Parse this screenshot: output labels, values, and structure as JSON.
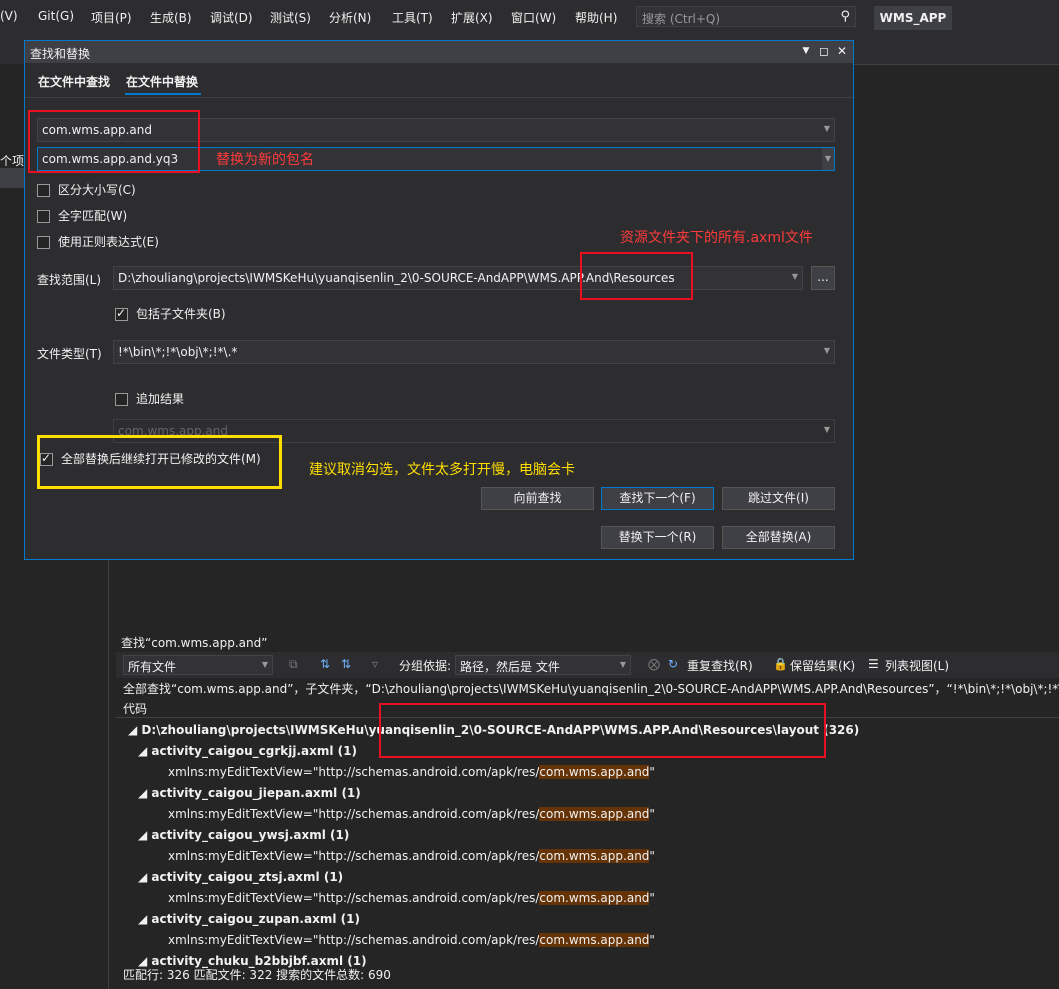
{
  "menu": [
    "(V)",
    "Git(G)",
    "项目(P)",
    "生成(B)",
    "调试(D)",
    "测试(S)",
    "分析(N)",
    "工具(T)",
    "扩展(X)",
    "窗口(W)",
    "帮助(H)"
  ],
  "search": {
    "placeholder": "搜索 (Ctrl+Q)"
  },
  "app_title": "WMS_APP",
  "left_panel": {
    "label": "个项目"
  },
  "dialog": {
    "title": "查找和替换",
    "tabs": [
      "在文件中查找",
      "在文件中替换"
    ],
    "active_tab": "在文件中替换",
    "find_value": "com.wms.app.and",
    "replace_value": "com.wms.app.and.yq3",
    "options": {
      "match_case": "区分大小写(C)",
      "whole_word": "全字匹配(W)",
      "regex": "使用正则表达式(E)"
    },
    "scope_label": "查找范围(L)",
    "scope_value": "D:\\zhouliang\\projects\\IWMSKeHu\\yuanqisenlin_2\\0-SOURCE-AndAPP\\WMS.APP.And\\Resources",
    "browse_label": "...",
    "include_subfolders": "包括子文件夹(B)",
    "filetype_label": "文件类型(T)",
    "filetype_value": "!*\\bin\\*;!*\\obj\\*;!*\\.*",
    "append_results": "追加结果",
    "disabled_value": "com.wms.app.and",
    "keep_open": "全部替换后继续打开已修改的文件(M)",
    "buttons": {
      "find_prev": "向前查找",
      "find_next": "查找下一个(F)",
      "skip_file": "跳过文件(I)",
      "replace_next": "替换下一个(R)",
      "replace_all": "全部替换(A)"
    }
  },
  "annotations": {
    "replace_note": "替换为新的包名",
    "scope_note": "资源文件夹下的所有.axml文件",
    "keep_open_note": "建议取消勾选，文件太多打开慢，电脑会卡"
  },
  "results": {
    "title": "查找“com.wms.app.and”",
    "filter": "所有文件",
    "group_label": "分组依据:",
    "group_value": "路径，然后是 文件",
    "repeat_find": "重复查找(R)",
    "keep_results": "保留结果(K)",
    "list_view": "列表视图(L)",
    "summary": "全部查找“com.wms.app.and”，子文件夹，“D:\\zhouliang\\projects\\IWMSKeHu\\yuanqisenlin_2\\0-SOURCE-AndAPP\\WMS.APP.And\\Resources”，“!*\\bin\\*;!*\\obj\\*;!*\\.*”",
    "code_header": "代码",
    "folder": "D:\\zhouliang\\projects\\IWMSKeHu\\yuanqisenlin_2\\0-SOURCE-AndAPP\\WMS.APP.And\\Resources\\layout  (326)",
    "line_prefix": "xmlns:myEditTextView=\"http://schemas.android.com/apk/res/",
    "line_match": "com.wms.app.and",
    "line_suffix": "\"",
    "files": [
      "activity_caigou_cgrkjj.axml  (1)",
      "activity_caigou_jiepan.axml  (1)",
      "activity_caigou_ywsj.axml  (1)",
      "activity_caigou_ztsj.axml  (1)",
      "activity_caigou_zupan.axml  (1)",
      "activity_chuku_b2bbjbf.axml  (1)"
    ],
    "status": "匹配行: 326 匹配文件: 322 搜索的文件总数: 690"
  }
}
